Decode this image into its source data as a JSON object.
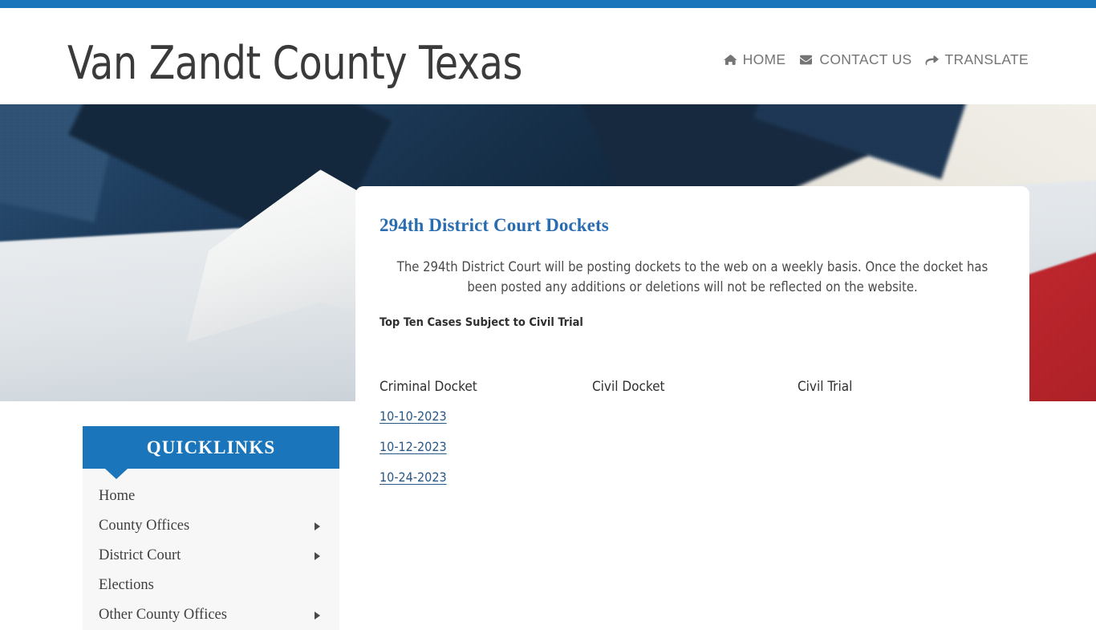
{
  "site": {
    "title": "Van Zandt County Texas",
    "accent_color": "#1b75bb"
  },
  "nav": {
    "items": [
      {
        "label": "HOME",
        "icon": "home-icon"
      },
      {
        "label": "CONTACT US",
        "icon": "envelope-icon"
      },
      {
        "label": "TRANSLATE",
        "icon": "share-arrow-icon"
      }
    ]
  },
  "hero": {
    "alt": "Close-up photograph of an American flag"
  },
  "card": {
    "title": "294th District Court Dockets",
    "paragraph": "The 294th District Court will be posting dockets to the web on a weekly basis. Once the docket has been posted any additions or deletions will not be reflected on the website.",
    "subheading": "Top Ten Cases Subject to Civil Trial",
    "table": {
      "headers": [
        "Criminal Docket",
        "Civil Docket",
        "Civil Trial"
      ],
      "rows": [
        {
          "criminal_docket": "10-10-2023",
          "civil_docket": "",
          "civil_trial": ""
        },
        {
          "criminal_docket": "10-12-2023",
          "civil_docket": "",
          "civil_trial": ""
        },
        {
          "criminal_docket": "10-24-2023",
          "civil_docket": "",
          "civil_trial": ""
        }
      ]
    }
  },
  "quicklinks": {
    "heading": "QUICKLINKS",
    "items": [
      {
        "label": "Home",
        "has_submenu": false
      },
      {
        "label": "County Offices",
        "has_submenu": true
      },
      {
        "label": "District Court",
        "has_submenu": true
      },
      {
        "label": "Elections",
        "has_submenu": false
      },
      {
        "label": "Other County Offices",
        "has_submenu": true
      }
    ]
  }
}
